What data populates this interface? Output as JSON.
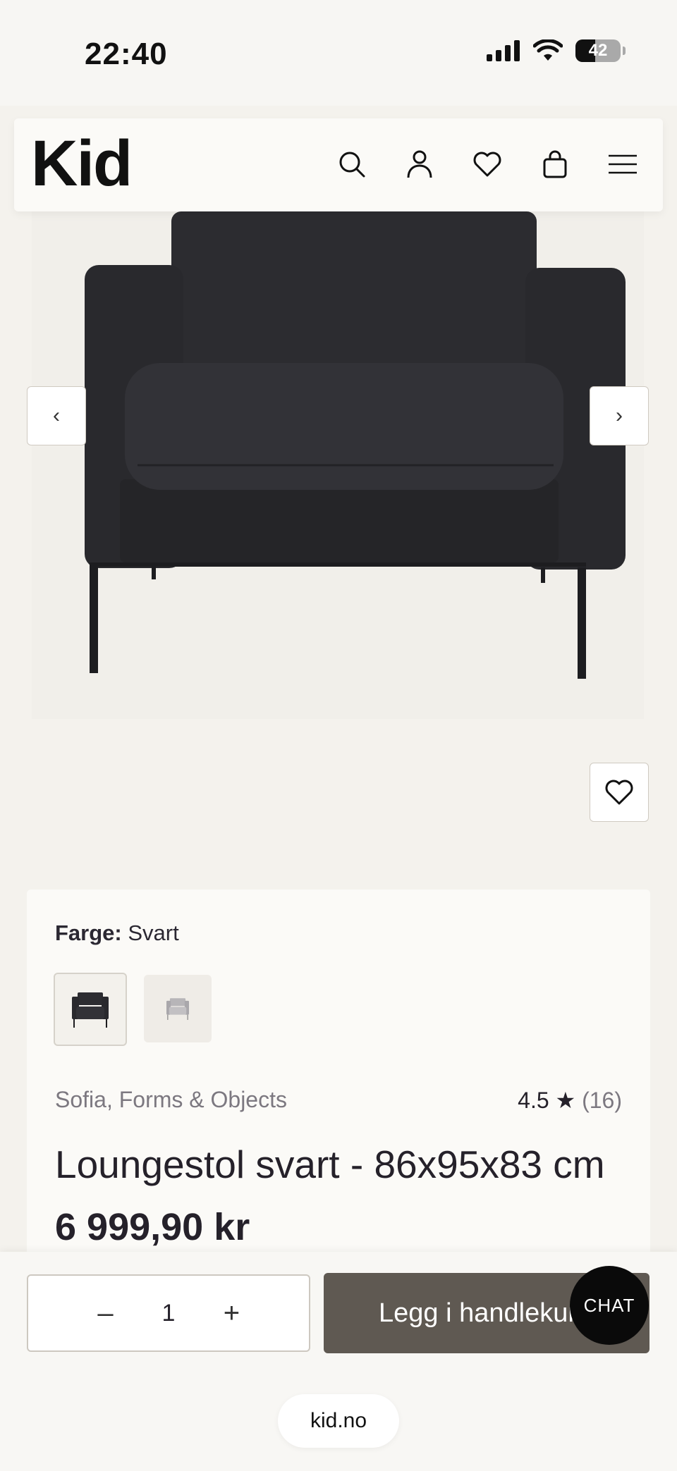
{
  "status_bar": {
    "time": "22:40",
    "battery": "42"
  },
  "header": {
    "logo": "Kid",
    "icons": [
      "search-icon",
      "account-icon",
      "heart-icon",
      "bag-icon",
      "menu-icon"
    ]
  },
  "gallery": {
    "prev_label": "‹",
    "next_label": "›"
  },
  "product": {
    "color_label": "Farge:",
    "color_value": "Svart",
    "brand": "Sofia, Forms & Objects",
    "rating": "4.5 ★",
    "review_count": "(16)",
    "title": "Loungestol svart - 86x95x83 cm",
    "price": "6 999,90 kr"
  },
  "cart": {
    "quantity": "1",
    "minus": "–",
    "plus": "+",
    "add_label": "Legg i handlekurv",
    "chat_label": "CHAT"
  },
  "browser": {
    "url": "kid.no"
  },
  "colors": {
    "accent": "#5f5952",
    "background": "#f4f2ed",
    "chair": "#2b2b2e"
  }
}
